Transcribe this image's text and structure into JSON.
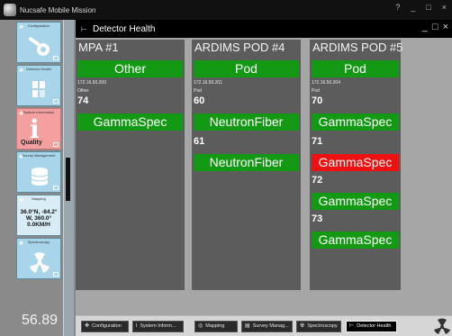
{
  "window": {
    "title": "Nucsafe Mobile Mission",
    "controls": [
      "?",
      "_",
      "□",
      "×"
    ]
  },
  "sidebar": {
    "tiles": [
      {
        "label": "Configuration"
      },
      {
        "label": "Detector Health"
      },
      {
        "label": "System Information",
        "status": "Quality"
      },
      {
        "label": "Survey Management"
      },
      {
        "label": "Mapping",
        "coords": [
          "36.0°N, -84.2°",
          "W, 360.0°",
          "0.0KM/H"
        ]
      },
      {
        "label": "Spectroscopy"
      }
    ],
    "bottom_value": "56.89"
  },
  "panel": {
    "title": "Detector Health",
    "controls": [
      "_",
      "□",
      "×"
    ],
    "detectors": [
      {
        "name": "MPA #1",
        "type": "Other",
        "ip": "172.16.50.200",
        "subtype": "Other",
        "sensors": [
          {
            "id": "74",
            "status": "GammaSpec",
            "alarm": false
          }
        ]
      },
      {
        "name": "ARDIMS POD #4",
        "type": "Pod",
        "ip": "172.16.50.201",
        "subtype": "Pod",
        "sensors": [
          {
            "id": "60",
            "status": "NeutronFiber",
            "alarm": false
          },
          {
            "id": "61",
            "status": "NeutronFiber",
            "alarm": false
          }
        ]
      },
      {
        "name": "ARDIMS POD #5",
        "type": "Pod",
        "ip": "172.16.50.204",
        "subtype": "Pod",
        "sensors": [
          {
            "id": "70",
            "status": "GammaSpec",
            "alarm": false
          },
          {
            "id": "71",
            "status": "GammaSpec",
            "alarm": true
          },
          {
            "id": "72",
            "status": "GammaSpec",
            "alarm": false
          },
          {
            "id": "73",
            "status": "GammaSpec",
            "alarm": false
          }
        ]
      }
    ]
  },
  "taskbar": {
    "items": [
      {
        "label": "Configuration",
        "icon": "configuration-icon",
        "active": false
      },
      {
        "label": "System Inform...",
        "icon": "info-icon",
        "active": false
      },
      {
        "label": "Mapping",
        "icon": "mapping-icon",
        "active": false
      },
      {
        "label": "Survey Manag...",
        "icon": "survey-icon",
        "active": false
      },
      {
        "label": "Spectroscopy",
        "icon": "spectroscopy-icon",
        "active": false
      },
      {
        "label": "Detector Health",
        "icon": "detector-health-icon",
        "active": true
      }
    ]
  },
  "colors": {
    "ok": "#149914",
    "alarm": "#ee1111",
    "header_bg": "#000000",
    "column_bg": "#5c5c5c"
  }
}
